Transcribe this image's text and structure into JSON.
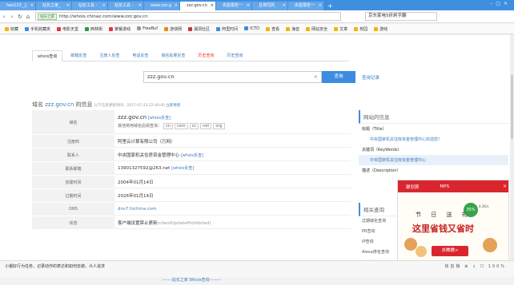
{
  "tabs": [
    "hao123_上",
    "站长之家_",
    "站长工具 -",
    "站长工具 -",
    "www.zzz.g",
    "zzz.gov.cn",
    "实验报告一",
    "且将同风",
    "实验报告一"
  ],
  "address": {
    "badge": "站长之家",
    "url": "http://whois.chinaz.com/www.zzz.gov.cn",
    "search": "京东家电5折剁手翻"
  },
  "bookmarks": [
    "收藏",
    "手机收藏夹",
    "电影天堂",
    "西林街",
    "聚餐游戏",
    "FreeBuf",
    "游侠网",
    "漏洞社区",
    "阿里时间",
    "ICTO",
    "查看",
    "海音",
    "网站安全",
    "文章",
    "校园",
    "游戏"
  ],
  "query_tabs": [
    "whois查询",
    "邮箱反查",
    "注册人反查",
    "电话反查",
    "域名批量反查",
    "历史查询",
    "历史查询"
  ],
  "search": {
    "value": "zzz.gov.cn",
    "button": "查询",
    "history": "查询记录"
  },
  "header": {
    "prefix": "域名",
    "domain": "zzz.gov.cn",
    "suffix": "的信息",
    "updated": "以下信息更新时间：2017-07-23 22:40:00",
    "refresh": "立即更新"
  },
  "rows": [
    {
      "label": "域名",
      "value": "zzz.gov.cn",
      "link": "[whois反查]",
      "sub": "其他常用域名后缀查询：",
      "chips": [
        "cn",
        "com",
        "cc",
        "net",
        "org"
      ]
    },
    {
      "label": "注册商",
      "value": "阿里云计算有限公司（万网）"
    },
    {
      "label": "联系人",
      "value": "中央国家机关住房资金管理中心",
      "link": "[whois反查]"
    },
    {
      "label": "联系邮箱",
      "value": "13901327592@263.net",
      "link": "[whois反查]"
    },
    {
      "label": "创建时间",
      "value": "2004年01月14日"
    },
    {
      "label": "过期时间",
      "value": "2026年01月14日"
    },
    {
      "label": "DNS",
      "value": "dns7.hichina.com"
    },
    {
      "label": "状态",
      "value": "客户端设置禁止更新",
      "extra": "(clientUpdateProhibited)"
    }
  ],
  "footer": "-------站长之家 Whois查询--------",
  "side": {
    "title": "网站的信息",
    "label1": "标题（Title）",
    "title_val": "中央国家机关住房资金管理中心欢迎您！",
    "label2": "关键词（KeyWords）",
    "kw_val": "中央国家机关住房资金管理中心",
    "desc": "描述（Description）"
  },
  "side2": {
    "title": "相关查询",
    "items": [
      "过期域名查询",
      "PR查询",
      "IP查询",
      "Alexa排名查询",
      "友链查询"
    ]
  },
  "ad": {
    "brand": "聚划算",
    "brand2": "MPS",
    "line1": "节 日 送 礼",
    "line2": "这里省钱又省时",
    "button": "去瞧瞧>",
    "speed": "35%",
    "speedtext": "0.2K/s"
  },
  "status": {
    "text": "小猴好行为任务，记录动作的表达和如何去做，众人追求",
    "right": "快剪辑  ⊕  ↓  ☐  100%"
  }
}
